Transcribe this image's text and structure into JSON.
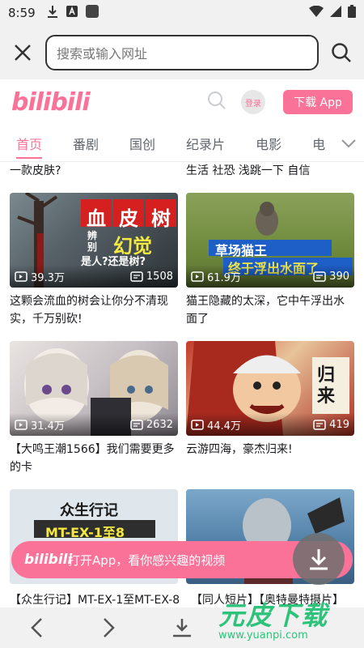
{
  "status_bar": {
    "time": "8:59"
  },
  "url_bar": {
    "placeholder": "搜索或输入网址"
  },
  "header": {
    "logo": "bilibili",
    "login": "登录",
    "download": "下载 App"
  },
  "tabs": [
    "首页",
    "番剧",
    "国创",
    "纪录片",
    "电影",
    "电"
  ],
  "top_cut": {
    "left": "一款皮肤?",
    "right": "生活 社恐 浅跳一下 自信"
  },
  "cards": [
    {
      "title": "这颗会流血的树会让你分不清现实，千万别砍!",
      "views": "39.3万",
      "danmaku": "1508",
      "overlay": [
        "血",
        "皮",
        "树",
        "幻觉",
        "辨别",
        "是人?还是树?"
      ]
    },
    {
      "title": "猫王隐藏的太深，它中午浮出水面了",
      "views": "61.9万",
      "danmaku": "390",
      "overlay": [
        "草场猫王",
        "终于浮出水面了"
      ]
    },
    {
      "title": "【大鸣王潮1566】我们需要更多的卡",
      "views": "31.4万",
      "danmaku": "2632"
    },
    {
      "title": "云游四海，豪杰归来!",
      "views": "44.4万",
      "danmaku": "419",
      "overlay": [
        "归来"
      ]
    },
    {
      "title": "【众生行记】MT-EX-1至MT-EX-8",
      "overlay": [
        "众生行记",
        "MT-EX-1至8"
      ]
    },
    {
      "title": "【同人短片】【奥特曼特摄片】"
    }
  ],
  "open_app_banner": {
    "logo": "bilibili",
    "text": "打开App，看你感兴趣的视频"
  },
  "watermark": {
    "main": "元皮下载",
    "sub": "www.yuanpi.com"
  },
  "colors": {
    "accent": "#fb7299",
    "watermark": "#2ec37a"
  }
}
